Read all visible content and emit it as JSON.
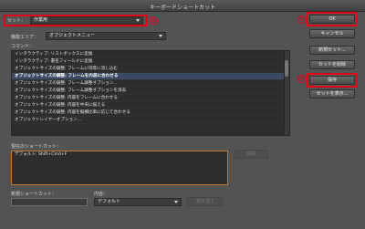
{
  "window": {
    "title": "キーボードショートカット"
  },
  "set": {
    "label": "セット：",
    "value": "作業用",
    "badge": "①"
  },
  "area": {
    "label": "機能エリア：",
    "value": "オブジェクトメニュー"
  },
  "commands": {
    "label": "コマンド：",
    "rows": [
      "インタラクティブ: リストボックスに変換",
      "インタラクティブ: 署名フィールドに変換",
      "オブジェクトサイズの調整: フレームに均等に流し込む",
      "オブジェクトサイズの調整: フレームを内容に合わせる",
      "オブジェクトサイズの調整: フレーム調整オプション...",
      "オブジェクトサイズの調整: フレーム調整オプションを消去",
      "オブジェクトサイズの調整: 内容をフレームに合わせる",
      "オブジェクトサイズの調整: 内容を中央に揃える",
      "オブジェクトサイズの調整: 内容を縦横比率に応じて合わせる",
      "オブジェクトレイヤーオプション..."
    ],
    "selected_index": 3
  },
  "current": {
    "label": "現在のショートカット：",
    "entries": [
      "デフォルト: Shift+Cmd+F"
    ],
    "remove_label": "削除"
  },
  "newshortcut": {
    "label": "新規ショートカット：",
    "context_label": "内容：",
    "context_value": "デフォルト",
    "assign_label": "割り当て"
  },
  "buttons": {
    "ok": "OK",
    "cancel": "キャンセル",
    "new_set": "新規セット...",
    "delete_set": "セットを削除",
    "save": "保存",
    "show_set": "セットを表示..."
  },
  "badges": {
    "ok": "②",
    "save": "③"
  },
  "colors": {
    "highlight": "#e3001b",
    "selection": "#3b4a62"
  }
}
